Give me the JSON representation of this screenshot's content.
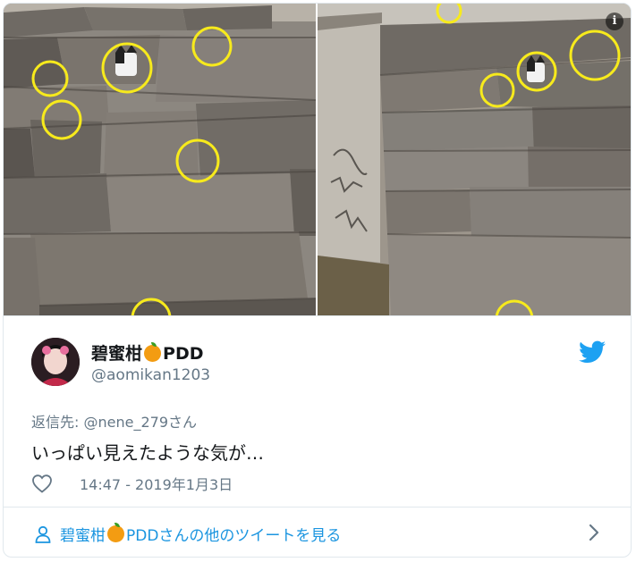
{
  "media": {
    "left_alt": "stone wall with cats highlighted",
    "right_alt": "stone wall with cats highlighted, angled view",
    "info_label": "i"
  },
  "author": {
    "display_name_prefix": "碧蜜柑",
    "display_name_suffix": "PDD",
    "handle": "@aomikan1203"
  },
  "tweet": {
    "reply_prefix": "返信先: ",
    "reply_to": "@nene_279さん",
    "text": "いっぱい見えたような気が…",
    "timestamp": "14:47 - 2019年1月3日"
  },
  "footer": {
    "link_prefix": "碧蜜柑",
    "link_suffix": "PDDさんの他のツイートを見る"
  },
  "colors": {
    "accent": "#1b95e0",
    "highlight_circle": "#f7ea1c",
    "muted": "#657786"
  }
}
